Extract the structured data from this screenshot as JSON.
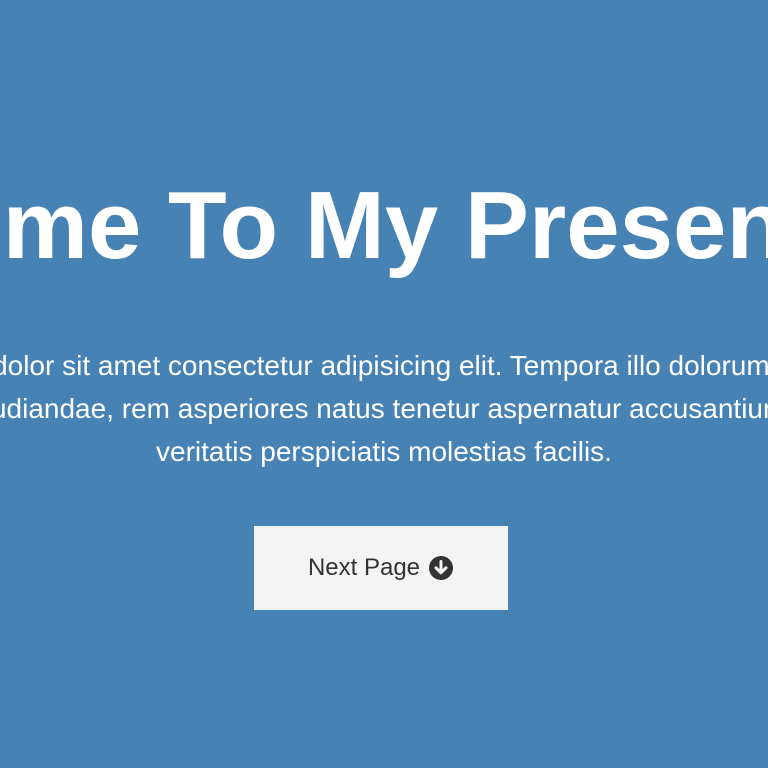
{
  "hero": {
    "title": "Welcome To My Presentation",
    "text": "Lorem ipsum dolor sit amet consectetur adipisicing elit. Tempora illo dolorum, commodi aut molestias repudiandae, rem asperiores natus tenetur aspernatur accusantium voluptatibus veritatis perspiciatis molestias facilis."
  },
  "button": {
    "label": "Next Page",
    "icon": "arrow-circle-down-icon"
  },
  "colors": {
    "background": "#4682b4",
    "text": "#ffffff",
    "button_background": "#f4f4f4",
    "button_text": "#333333"
  }
}
